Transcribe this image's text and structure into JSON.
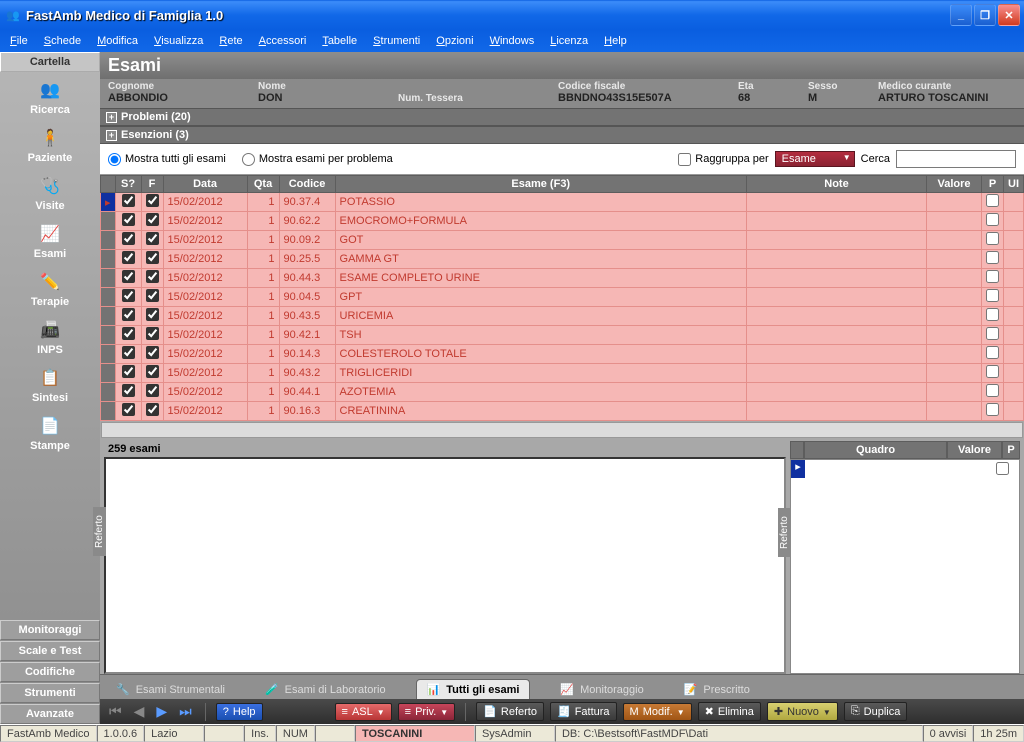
{
  "window": {
    "title": "FastAmb Medico di Famiglia 1.0"
  },
  "menu": [
    "File",
    "Schede",
    "Modifica",
    "Visualizza",
    "Rete",
    "Accessori",
    "Tabelle",
    "Strumenti",
    "Opzioni",
    "Windows",
    "Licenza",
    "Help"
  ],
  "sidebar": {
    "header": "Cartella",
    "items": [
      {
        "label": "Ricerca",
        "icon": "👥"
      },
      {
        "label": "Paziente",
        "icon": "🧍"
      },
      {
        "label": "Visite",
        "icon": "🩺"
      },
      {
        "label": "Esami",
        "icon": "📈"
      },
      {
        "label": "Terapie",
        "icon": "✏️"
      },
      {
        "label": "INPS",
        "icon": "📠"
      },
      {
        "label": "Sintesi",
        "icon": "📋"
      },
      {
        "label": "Stampe",
        "icon": "📄"
      }
    ],
    "bottom": [
      "Monitoraggi",
      "Scale e Test",
      "Codifiche",
      "Strumenti",
      "Avanzate"
    ]
  },
  "page": {
    "title": "Esami"
  },
  "patient": {
    "fields": [
      {
        "label": "Cognome",
        "value": "ABBONDIO"
      },
      {
        "label": "Nome",
        "value": "DON"
      },
      {
        "label": "Num. Tessera",
        "value": ""
      },
      {
        "label": "Codice fiscale",
        "value": "BBNDNO43S15E507A"
      },
      {
        "label": "Eta",
        "value": "68"
      },
      {
        "label": "Sesso",
        "value": "M"
      },
      {
        "label": "Medico curante",
        "value": "ARTURO TOSCANINI"
      }
    ]
  },
  "sections": {
    "problemi": "Problemi (20)",
    "esenzioni": "Esenzioni (3)"
  },
  "filters": {
    "all_label": "Mostra tutti gli esami",
    "by_problem_label": "Mostra esami per problema",
    "group_label": "Raggruppa per",
    "group_value": "Esame",
    "search_label": "Cerca"
  },
  "table": {
    "headers": {
      "s": "S?",
      "f": "F",
      "data": "Data",
      "qta": "Qta",
      "codice": "Codice",
      "esame": "Esame (F3)",
      "note": "Note",
      "valore": "Valore",
      "p": "P",
      "ui": "UI"
    },
    "rows": [
      {
        "data": "15/02/2012",
        "qta": "1",
        "codice": "90.37.4",
        "esame": "POTASSIO"
      },
      {
        "data": "15/02/2012",
        "qta": "1",
        "codice": "90.62.2",
        "esame": "EMOCROMO+FORMULA"
      },
      {
        "data": "15/02/2012",
        "qta": "1",
        "codice": "90.09.2",
        "esame": "GOT"
      },
      {
        "data": "15/02/2012",
        "qta": "1",
        "codice": "90.25.5",
        "esame": "GAMMA GT"
      },
      {
        "data": "15/02/2012",
        "qta": "1",
        "codice": "90.44.3",
        "esame": "ESAME COMPLETO URINE"
      },
      {
        "data": "15/02/2012",
        "qta": "1",
        "codice": "90.04.5",
        "esame": "GPT"
      },
      {
        "data": "15/02/2012",
        "qta": "1",
        "codice": "90.43.5",
        "esame": "URICEMIA"
      },
      {
        "data": "15/02/2012",
        "qta": "1",
        "codice": "90.42.1",
        "esame": "TSH"
      },
      {
        "data": "15/02/2012",
        "qta": "1",
        "codice": "90.14.3",
        "esame": "COLESTEROLO TOTALE"
      },
      {
        "data": "15/02/2012",
        "qta": "1",
        "codice": "90.43.2",
        "esame": "TRIGLICERIDI"
      },
      {
        "data": "15/02/2012",
        "qta": "1",
        "codice": "90.44.1",
        "esame": "AZOTEMIA"
      },
      {
        "data": "15/02/2012",
        "qta": "1",
        "codice": "90.16.3",
        "esame": "CREATININA"
      }
    ]
  },
  "detail": {
    "count": "259 esami",
    "referto": "Referto",
    "mini_headers": {
      "quadro": "Quadro",
      "valore": "Valore",
      "p": "P"
    }
  },
  "tabs": [
    {
      "label": "Esami Strumentali",
      "icon": "🔧"
    },
    {
      "label": "Esami di Laboratorio",
      "icon": "🧪"
    },
    {
      "label": "Tutti gli esami",
      "icon": "📊",
      "active": true
    },
    {
      "label": "Monitoraggio",
      "icon": "📈"
    },
    {
      "label": "Prescritto",
      "icon": "📝"
    }
  ],
  "actions": {
    "help": "Help",
    "asl": "ASL",
    "priv": "Priv.",
    "referto": "Referto",
    "fattura": "Fattura",
    "modif": "Modif.",
    "elimina": "Elimina",
    "nuovo": "Nuovo",
    "duplica": "Duplica"
  },
  "status": {
    "app": "FastAmb Medico",
    "ver": "1.0.0.6",
    "region": "Lazio",
    "ins": "Ins.",
    "num": "NUM",
    "doctor": "TOSCANINI",
    "user": "SysAdmin",
    "db": "DB: C:\\Bestsoft\\FastMDF\\Dati",
    "avvisi": "0 avvisi",
    "time": "1h 25m"
  }
}
